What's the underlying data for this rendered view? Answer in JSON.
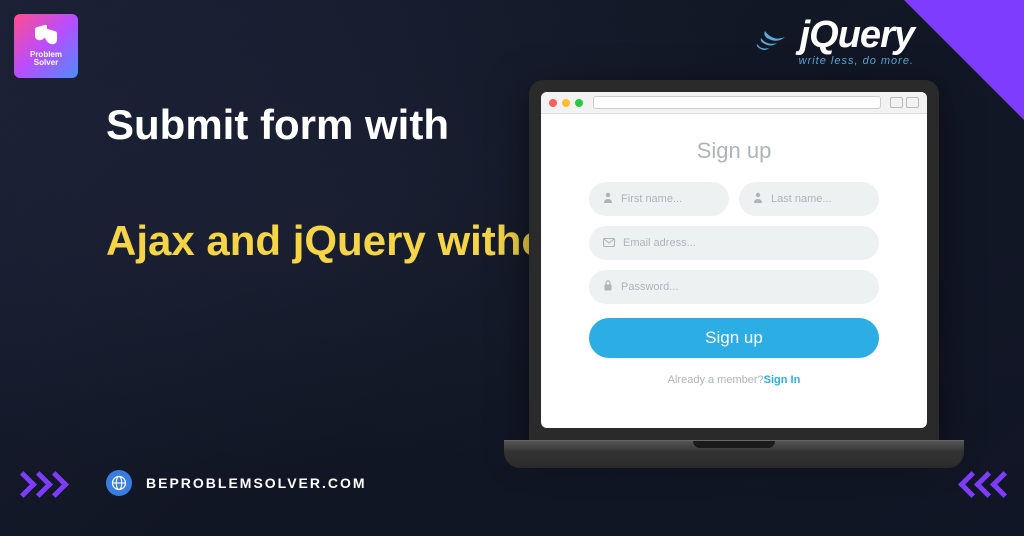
{
  "logo": {
    "line1": "Problem",
    "line2": "Solver"
  },
  "headline": "Submit form with",
  "subhead": "Ajax and jQuery without reloading page",
  "jquery": {
    "name": "jQuery",
    "tagline": "write less, do more."
  },
  "form": {
    "title": "Sign up",
    "first_name_ph": "First name...",
    "last_name_ph": "Last name...",
    "email_ph": "Email adress...",
    "password_ph": "Password...",
    "submit_label": "Sign up",
    "member_text": "Already a member?",
    "signin_label": "Sign In"
  },
  "footer": {
    "url": "BEPROBLEMSOLVER.COM"
  }
}
